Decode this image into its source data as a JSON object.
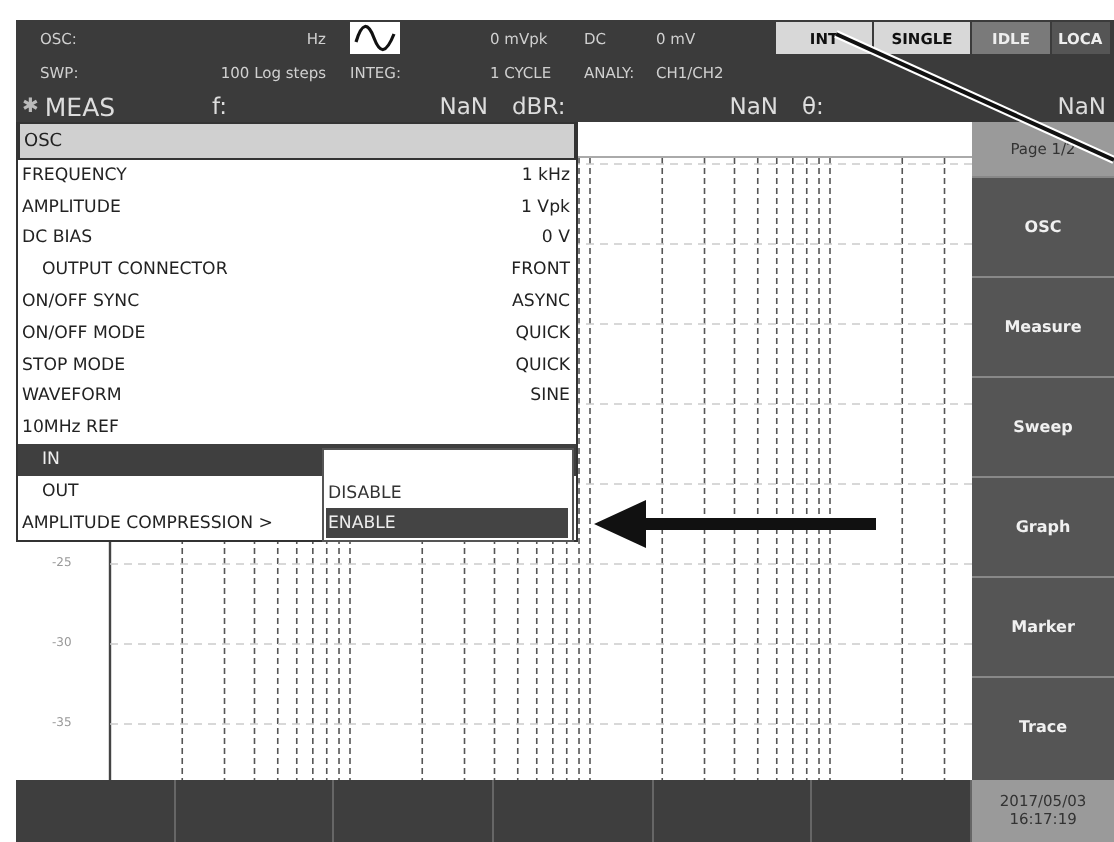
{
  "status": {
    "osc_label": "OSC:",
    "osc_unit": "Hz",
    "osc_amplitude": "0 mVpk",
    "dc_label": "DC",
    "dc_value": "0 mV",
    "swp_label": "SWP:",
    "swp_steps": "100 Log steps",
    "integ_label": "INTEG:",
    "integ_value": "1 CYCLE",
    "analy_label": "ANALY:",
    "analy_value": "CH1/CH2"
  },
  "buttons": [
    {
      "label": "INT",
      "kind": "light"
    },
    {
      "label": "SINGLE",
      "kind": "light"
    },
    {
      "label": "IDLE",
      "kind": "mid"
    },
    {
      "label": "LOCA",
      "kind": "dark"
    }
  ],
  "measure": {
    "mark": "✱",
    "title": "MEAS",
    "fields": [
      {
        "label": "f:",
        "value": "NaN"
      },
      {
        "label": "dBR:",
        "value": "NaN"
      },
      {
        "label": "θ:",
        "value": "NaN"
      }
    ]
  },
  "menu": {
    "title": "OSC",
    "items": [
      {
        "label": "FREQUENCY",
        "value": "1 kHz",
        "selected": false
      },
      {
        "label": "AMPLITUDE",
        "value": "1 Vpk",
        "selected": false
      },
      {
        "label": "DC BIAS",
        "value": "0 V",
        "selected": false,
        "children": [
          {
            "label": "OUTPUT CONNECTOR",
            "value": "FRONT",
            "selected": false
          }
        ]
      },
      {
        "label": "ON/OFF SYNC",
        "value": "ASYNC",
        "selected": false
      },
      {
        "label": "ON/OFF MODE",
        "value": "QUICK",
        "selected": false
      },
      {
        "label": "STOP MODE",
        "value": "QUICK",
        "selected": false
      },
      {
        "label": "WAVEFORM",
        "value": "SINE",
        "selected": false
      },
      {
        "label": "10MHz REF",
        "selected": false,
        "children": [
          {
            "label": "IN",
            "selected": true
          },
          {
            "label": "OUT",
            "selected": false
          }
        ]
      },
      {
        "label": "AMPLITUDE COMPRESSION >",
        "selected": false
      }
    ]
  },
  "submenu": {
    "options": [
      {
        "label": "DISABLE",
        "selected": false
      },
      {
        "label": "ENABLE",
        "selected": true
      }
    ]
  },
  "graph": {
    "y_labels": [
      "-25",
      "-30",
      "-35"
    ]
  },
  "side_panel": {
    "page": "Page 1/2",
    "buttons": [
      "OSC",
      "Measure",
      "Sweep",
      "Graph",
      "Marker",
      "Trace"
    ]
  },
  "bottom_bar": {
    "date": "2017/05/03",
    "time": "16:17:19"
  }
}
